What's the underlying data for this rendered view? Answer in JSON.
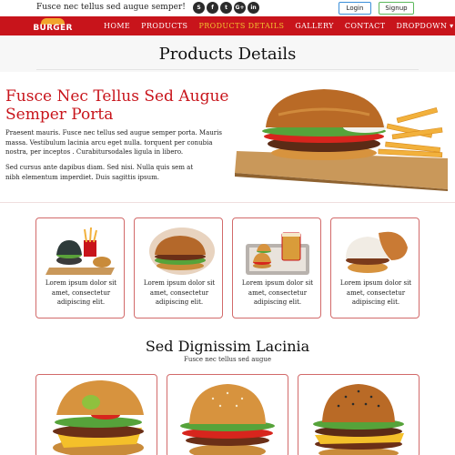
{
  "topbar": {
    "tagline": "Fusce nec tellus sed augue semper!",
    "social": [
      "S",
      "f",
      "t",
      "G+",
      "in"
    ],
    "login_label": "Login",
    "signup_label": "Signup"
  },
  "nav": {
    "logo_text": "BURGER",
    "items": [
      {
        "label": "HOME"
      },
      {
        "label": "PRODUCTS"
      },
      {
        "label": "PRODUCTS DETAILS"
      },
      {
        "label": "GALLERY"
      },
      {
        "label": "CONTACT"
      },
      {
        "label": "DROPDOWN ▾"
      }
    ]
  },
  "page": {
    "title": "Products Details"
  },
  "hero": {
    "heading": "Fusce Nec Tellus Sed Augue Semper Porta",
    "para1": "Praesent mauris. Fusce nec tellus sed augue semper porta. Mauris massa. Vestibulum lacinia arcu eget nulla. torquent per conubia nostra, per inceptos . Curabitursodales ligula in libero.",
    "para2": "Sed cursus ante dapibus diam. Sed nisi. Nulla quis sem at nibh elementum imperdiet. Duis sagittis ipsum."
  },
  "cards": [
    {
      "caption": "Lorem ipsum dolor sit amet, consectetur adipiscing elit."
    },
    {
      "caption": "Lorem ipsum dolor sit amet, consectetur adipiscing elit."
    },
    {
      "caption": "Lorem ipsum dolor sit amet, consectetur adipiscing elit."
    },
    {
      "caption": "Lorem ipsum dolor sit amet, consectetur adipiscing elit."
    }
  ],
  "section2": {
    "title": "Sed Dignissim Lacinia",
    "subtitle": "Fusce nec tellus sed augue"
  },
  "colors": {
    "brand_red": "#c8141b",
    "active_nav": "#f2c230",
    "card_border": "#d26a6a"
  }
}
